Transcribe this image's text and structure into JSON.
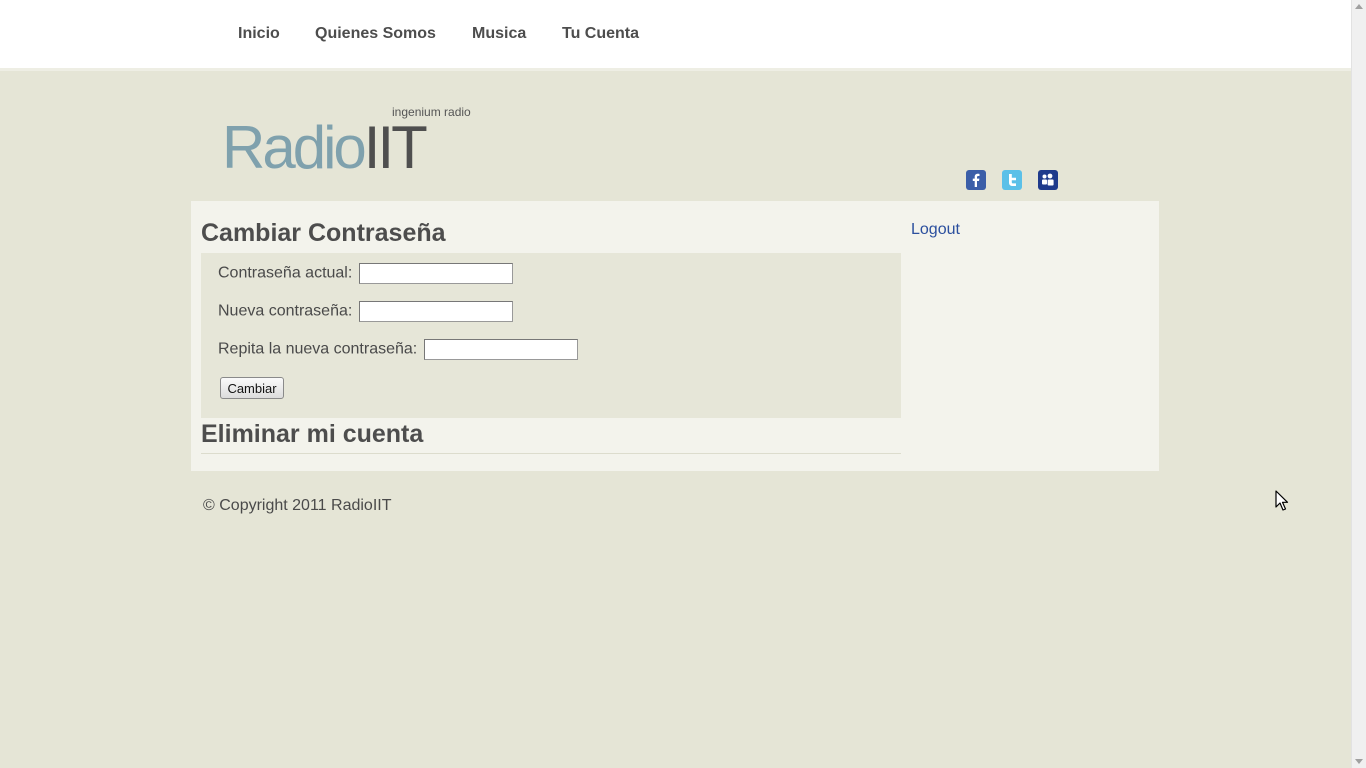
{
  "nav": {
    "items": [
      {
        "label": "Inicio"
      },
      {
        "label": "Quienes Somos"
      },
      {
        "label": "Musica"
      },
      {
        "label": "Tu Cuenta"
      }
    ]
  },
  "brand": {
    "tagline": "ingenium radio",
    "logo_part1": "Radio",
    "logo_part2": "IIT",
    "accent_color": "#7fa1ad"
  },
  "social": {
    "icons": [
      "facebook-icon",
      "twitter-icon",
      "myspace-icon"
    ]
  },
  "change_password": {
    "title": "Cambiar Contraseña",
    "current_label": "Contraseña actual:",
    "current_value": "",
    "new_label": "Nueva contraseña:",
    "new_value": "",
    "repeat_label": "Repita la nueva contraseña:",
    "repeat_value": "",
    "submit_label": "Cambiar"
  },
  "delete_account": {
    "title": "Eliminar mi cuenta"
  },
  "sidebar": {
    "logout_label": "Logout",
    "link_color": "#2b4f9e"
  },
  "footer": {
    "copyright": "© Copyright 2011 RadioIIT"
  },
  "colors": {
    "page_bg": "#e5e5d6",
    "content_bg": "#f3f3ec",
    "form_bg": "#e6e6d8"
  }
}
